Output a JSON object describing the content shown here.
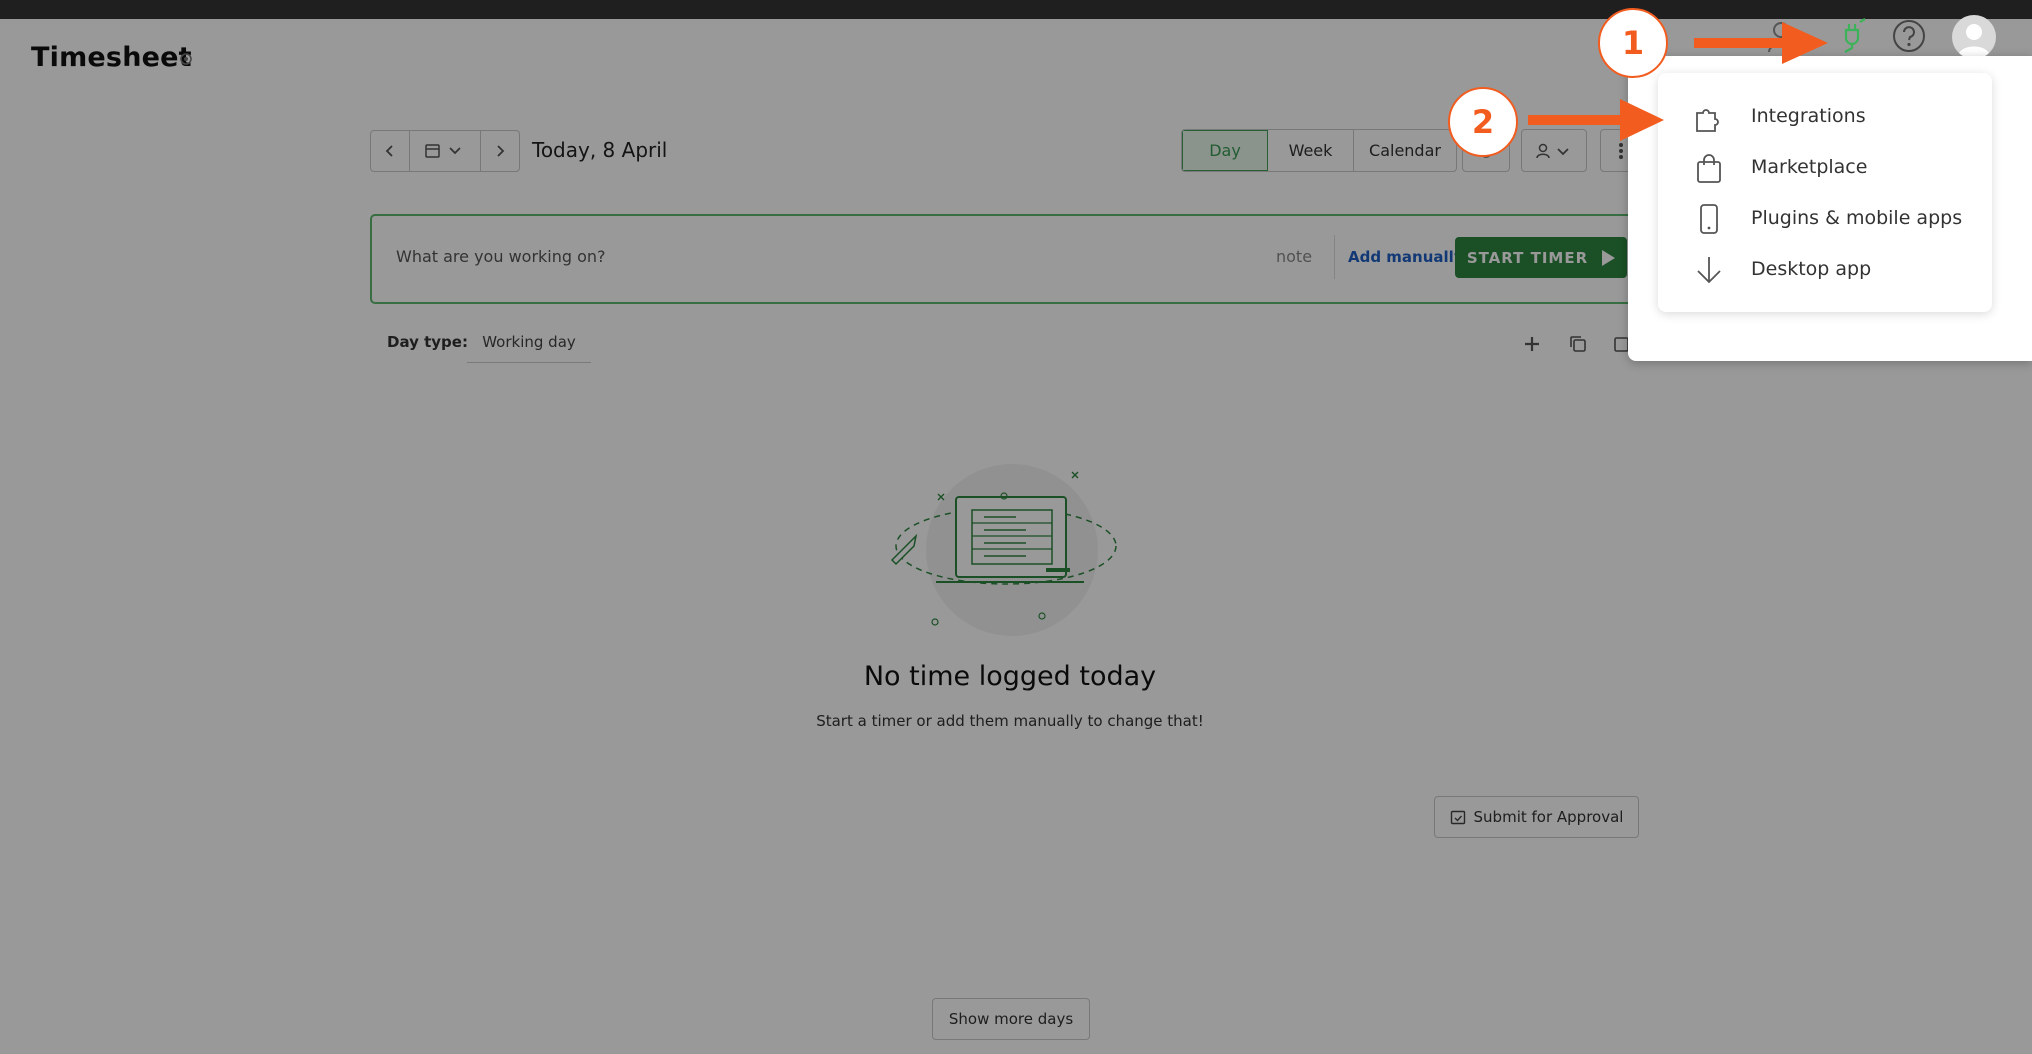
{
  "page": {
    "title": "Timesheet",
    "date_label": "Today, 8 April",
    "view_tabs": [
      "Day",
      "Week",
      "Calendar"
    ],
    "active_view": "Day"
  },
  "timer": {
    "placeholder": "What are you working on?",
    "note_label": "note",
    "add_manually_label": "Add manually",
    "start_label": "START TIMER"
  },
  "day_type": {
    "label": "Day type:",
    "value": "Working day"
  },
  "empty_state": {
    "title": "No time logged today",
    "subtitle": "Start a timer or add them manually to change that!"
  },
  "actions": {
    "submit_label": "Submit for Approval",
    "show_more_label": "Show more days"
  },
  "header_icons": [
    "person-icon",
    "plug-icon",
    "help-icon",
    "avatar"
  ],
  "dropdown": {
    "items": [
      {
        "label": "Integrations",
        "icon": "puzzle-icon"
      },
      {
        "label": "Marketplace",
        "icon": "bag-icon"
      },
      {
        "label": "Plugins & mobile apps",
        "icon": "phone-icon"
      },
      {
        "label": "Desktop app",
        "icon": "download-icon"
      }
    ]
  },
  "annotations": {
    "step1": "1",
    "step2": "2"
  },
  "colors": {
    "accent_green": "#2e8540",
    "annotation_orange": "#f25c1f",
    "link_blue": "#1f5fc4"
  }
}
